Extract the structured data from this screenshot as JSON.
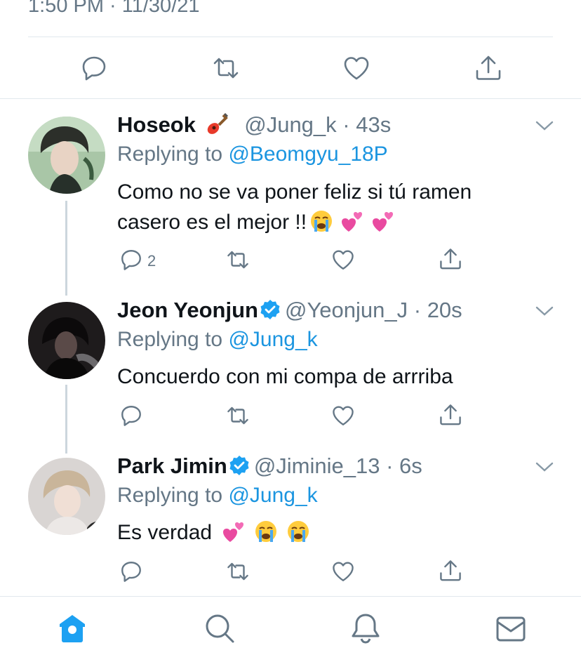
{
  "main_tweet": {
    "timestamp": "1:50 PM · 11/30/21"
  },
  "colors": {
    "accent": "#1da1f2",
    "link": "#1b95e0",
    "muted": "#657786",
    "divider": "#e1e8ed",
    "icon": "#657786"
  },
  "replies": [
    {
      "name": "Hoseok",
      "name_emoji": "guitar",
      "handle": "@Jung_k",
      "time": "43s",
      "verified": false,
      "replying_label": "Replying to",
      "replying_to": "@Beomgyu_18P",
      "text_line1": "Como no se va poner feliz si tú ramen",
      "text_line2": "casero es el mejor !!",
      "emojis": [
        "crying-face",
        "two-hearts",
        "two-hearts"
      ],
      "reply_count": "2"
    },
    {
      "name": "Jeon Yeonjun",
      "handle": "@Yeonjun_J",
      "time": "20s",
      "verified": true,
      "replying_label": "Replying to",
      "replying_to": "@Jung_k",
      "text_line1": "Concuerdo con mi compa de arrriba"
    },
    {
      "name": "Park Jimin",
      "handle": "@Jiminie_13",
      "time": "6s",
      "verified": true,
      "replying_label": "Replying to",
      "replying_to": "@Jung_k",
      "text_line1": "Es verdad",
      "emojis": [
        "two-hearts",
        "crying-face",
        "crying-face"
      ]
    }
  ],
  "bottom_nav": {
    "items": [
      "home-icon",
      "search-icon",
      "notifications-icon",
      "messages-icon"
    ],
    "active": "home-icon"
  }
}
